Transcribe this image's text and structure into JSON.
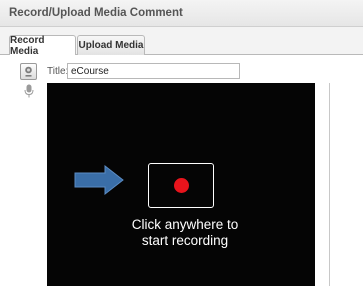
{
  "window": {
    "title": "Record/Upload Media Comment"
  },
  "tabs": [
    {
      "label": "Record Media",
      "active": true
    },
    {
      "label": "Upload Media",
      "active": false
    }
  ],
  "form": {
    "title_label": "Title:",
    "title_value": "eCourse"
  },
  "recorder": {
    "prompt_line1": "Click anywhere to",
    "prompt_line2": "start recording"
  },
  "icons": {
    "camera": "webcam-icon",
    "microphone": "microphone-icon",
    "arrow": "arrow-right-icon",
    "record": "record-dot-icon"
  },
  "colors": {
    "video_background": "#050505",
    "record_dot": "#e8141c",
    "arrow_fill": "#3a6ea8"
  }
}
